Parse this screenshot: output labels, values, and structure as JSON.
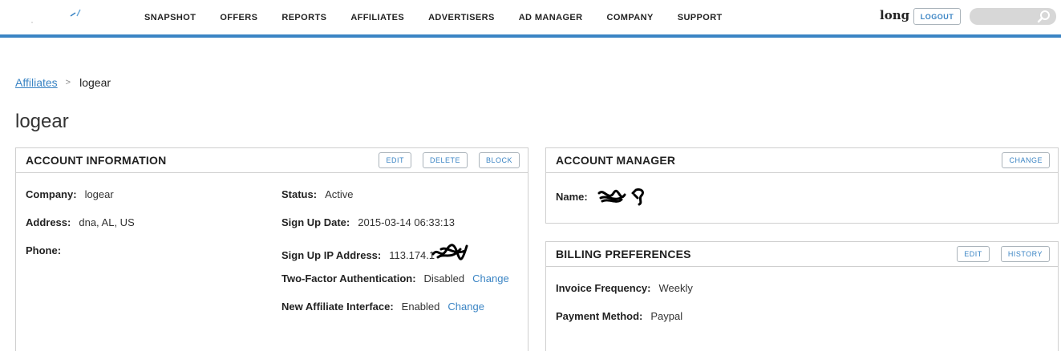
{
  "header": {
    "nav": [
      "SNAPSHOT",
      "OFFERS",
      "REPORTS",
      "AFFILIATES",
      "ADVERTISERS",
      "AD MANAGER",
      "COMPANY",
      "SUPPORT"
    ],
    "username": "long",
    "logout_label": "LOGOUT",
    "search": {
      "value": "",
      "placeholder": ""
    },
    "accent_color": "#3a84c4"
  },
  "breadcrumb": {
    "parent": "Affiliates",
    "separator": ">",
    "current": "logear"
  },
  "page_title": "logear",
  "account_info": {
    "title": "ACCOUNT INFORMATION",
    "actions": [
      "EDIT",
      "DELETE",
      "BLOCK"
    ],
    "company": {
      "label": "Company:",
      "value": "logear"
    },
    "address": {
      "label": "Address:",
      "value": "dna, AL, US"
    },
    "phone": {
      "label": "Phone:",
      "value": ""
    },
    "status": {
      "label": "Status:",
      "value": "Active"
    },
    "signup_date": {
      "label": "Sign Up Date:",
      "value": "2015-03-14 06:33:13"
    },
    "signup_ip": {
      "label": "Sign Up IP Address:",
      "value": "113.174.1"
    },
    "two_factor": {
      "label": "Two-Factor Authentication:",
      "value": "Disabled",
      "link": "Change"
    },
    "new_interface": {
      "label": "New Affiliate Interface:",
      "value": "Enabled",
      "link": "Change"
    }
  },
  "account_manager": {
    "title": "ACCOUNT MANAGER",
    "action": "CHANGE",
    "name": {
      "label": "Name:"
    }
  },
  "billing": {
    "title": "BILLING PREFERENCES",
    "actions": [
      "EDIT",
      "HISTORY"
    ],
    "invoice_frequency": {
      "label": "Invoice Frequency:",
      "value": "Weekly"
    },
    "payment_method": {
      "label": "Payment Method:",
      "value": "Paypal"
    }
  }
}
